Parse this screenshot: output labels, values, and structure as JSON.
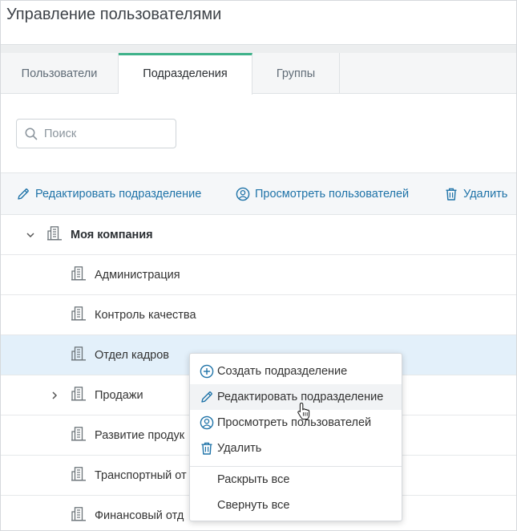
{
  "page": {
    "title": "Управление пользователями"
  },
  "tabs": [
    {
      "label": "Пользователи",
      "active": false
    },
    {
      "label": "Подразделения",
      "active": true
    },
    {
      "label": "Группы",
      "active": false
    }
  ],
  "search": {
    "placeholder": "Поиск",
    "value": ""
  },
  "toolbar": {
    "edit_label": "Редактировать подразделение",
    "view_label": "Просмотреть пользователей",
    "delete_label": "Удалить"
  },
  "tree": {
    "root": {
      "label": "Моя компания",
      "expanded": true
    },
    "items": [
      {
        "label": "Администрация",
        "selected": false,
        "expandable": false
      },
      {
        "label": "Контроль качества",
        "selected": false,
        "expandable": false
      },
      {
        "label": "Отдел кадров",
        "selected": true,
        "expandable": false
      },
      {
        "label": "Продажи",
        "selected": false,
        "expandable": true
      },
      {
        "label": "Развитие продук",
        "selected": false,
        "expandable": false
      },
      {
        "label": "Транспортный от",
        "selected": false,
        "expandable": false
      },
      {
        "label": "Финансовый отд",
        "selected": false,
        "expandable": false
      }
    ]
  },
  "context_menu": {
    "items": [
      {
        "label": "Создать подразделение",
        "icon": "plus-circle-icon"
      },
      {
        "label": "Редактировать подразделение",
        "icon": "pencil-icon"
      },
      {
        "label": "Просмотреть пользователей",
        "icon": "user-circle-icon"
      },
      {
        "label": "Удалить",
        "icon": "trash-icon"
      }
    ],
    "extra": [
      {
        "label": "Раскрыть все"
      },
      {
        "label": "Свернуть все"
      }
    ]
  },
  "colors": {
    "accent": "#1f73a8",
    "tab_active_border": "#3fb28a",
    "selected_row": "#e3f0fa"
  }
}
